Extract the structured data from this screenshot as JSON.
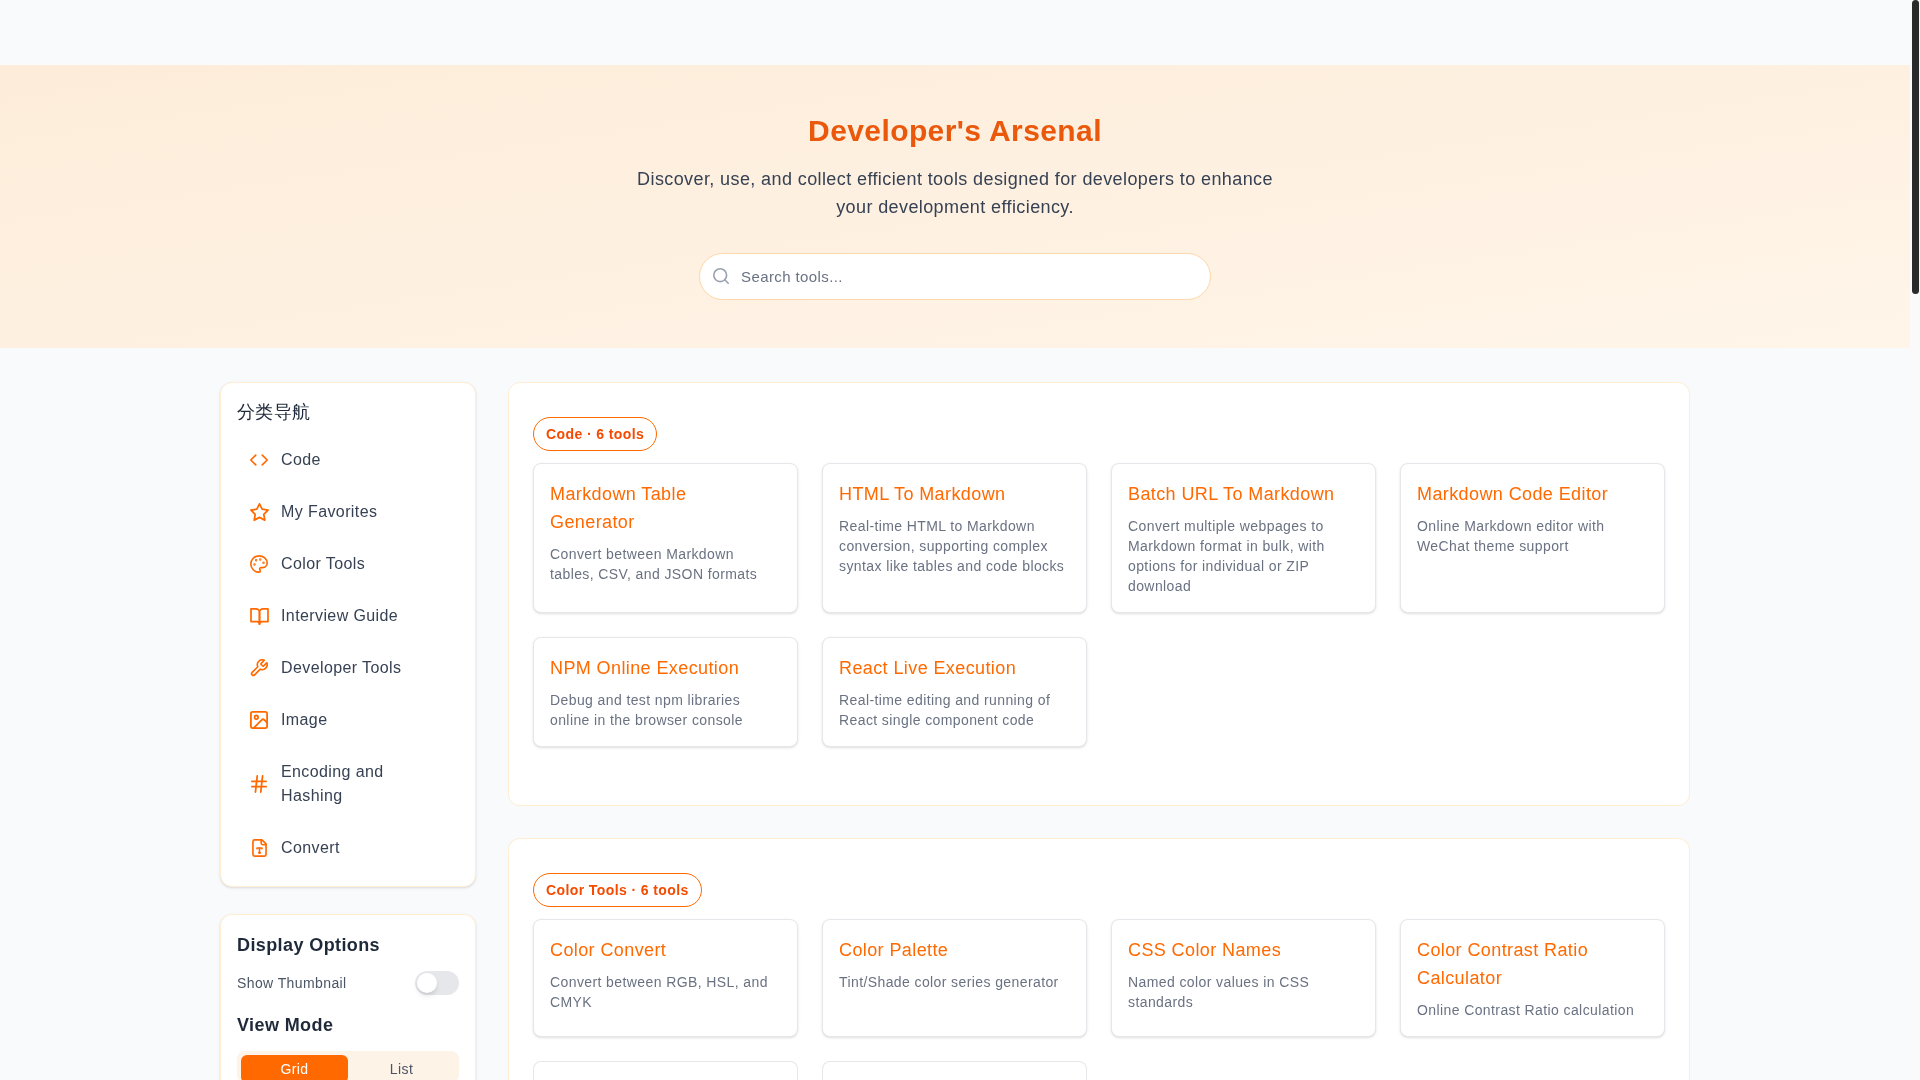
{
  "hero": {
    "title": "Developer's Arsenal",
    "subtitle": "Discover, use, and collect efficient tools designed for developers to enhance your development efficiency.",
    "search": {
      "placeholder": "Search tools..."
    }
  },
  "sidebar": {
    "title": "分类导航",
    "items": [
      {
        "label": "Code"
      },
      {
        "label": "My Favorites"
      },
      {
        "label": "Color Tools"
      },
      {
        "label": "Interview Guide"
      },
      {
        "label": "Developer Tools"
      },
      {
        "label": "Image"
      },
      {
        "label": "Encoding and Hashing"
      },
      {
        "label": "Convert"
      }
    ]
  },
  "display_options": {
    "title": "Display Options",
    "thumbnail_toggle": {
      "label": "Show Thumbnail",
      "on": false
    },
    "view_mode_title": "View Mode",
    "view_modes": [
      {
        "label": "Grid",
        "selected": true
      },
      {
        "label": "List",
        "selected": false
      }
    ]
  },
  "sections": [
    {
      "badge": "Code · 6 tools",
      "tools": [
        {
          "kind": "tool",
          "title": "Markdown Table Generator",
          "description": "Convert between Markdown tables, CSV, and JSON formats"
        },
        {
          "kind": "tool",
          "title": "HTML To Markdown",
          "description": "Real-time HTML to Markdown conversion, supporting complex syntax like tables and code blocks"
        },
        {
          "kind": "tool",
          "title": "Batch URL To Markdown",
          "description": "Convert multiple webpages to Markdown format in bulk, with options for individual or ZIP download"
        },
        {
          "kind": "tool",
          "title": "Markdown Code Editor",
          "description": "Online Markdown editor with WeChat theme support"
        },
        {
          "kind": "tool",
          "title": "NPM Online Execution",
          "description": "Debug and test npm libraries online in the browser console"
        },
        {
          "kind": "tool",
          "title": "React Live Execution",
          "description": "Real-time editing and running of React single component code"
        }
      ]
    },
    {
      "badge": "Color Tools · 6 tools",
      "tools": [
        {
          "kind": "tool",
          "title": "Color Convert",
          "description": "Convert between RGB, HSL, and CMYK"
        },
        {
          "kind": "tool",
          "title": "Color Palette",
          "description": "Tint/Shade color series generator"
        },
        {
          "kind": "tool",
          "title": "CSS Color Names",
          "description": "Named color values in CSS standards"
        },
        {
          "kind": "tool",
          "title": "Color Contrast Ratio Calculator",
          "description": "Online Contrast Ratio calculation"
        },
        {
          "kind": "clipped"
        },
        {
          "kind": "clipped"
        }
      ]
    }
  ]
}
